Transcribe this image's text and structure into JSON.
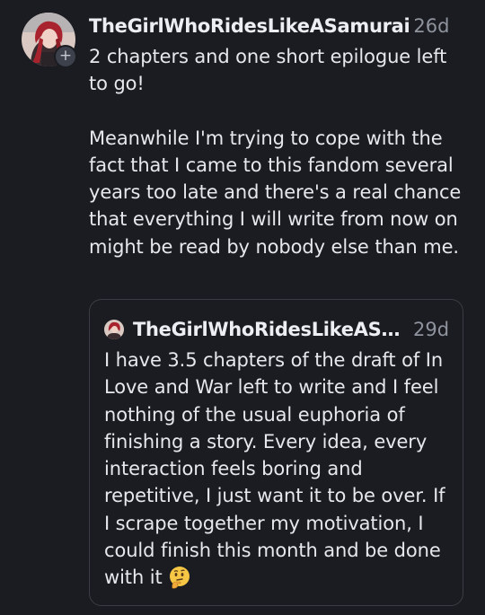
{
  "post": {
    "username": "TheGirlWhoRidesLikeASamurai",
    "time": "26d",
    "paragraph1": "2 chapters and one short epilogue left to go!",
    "paragraph2": "Meanwhile I'm trying to cope with the fact that I came to this fandom several years too late and there's a real chance that everything I will write from now on might be read by nobody else than me.",
    "follow_badge": "+"
  },
  "quoted_post": {
    "username": "TheGirlWhoRidesLikeASamurai",
    "time": "29d",
    "text": "I have 3.5 chapters of the draft of In Love and War left to write and I feel nothing of the usual euphoria of finishing a story. Every idea, every interaction feels boring and repetitive, I just want it to be over. If I scrape together my motivation, I could finish this month and be done with it",
    "emoji": "thinking-face-icon"
  }
}
